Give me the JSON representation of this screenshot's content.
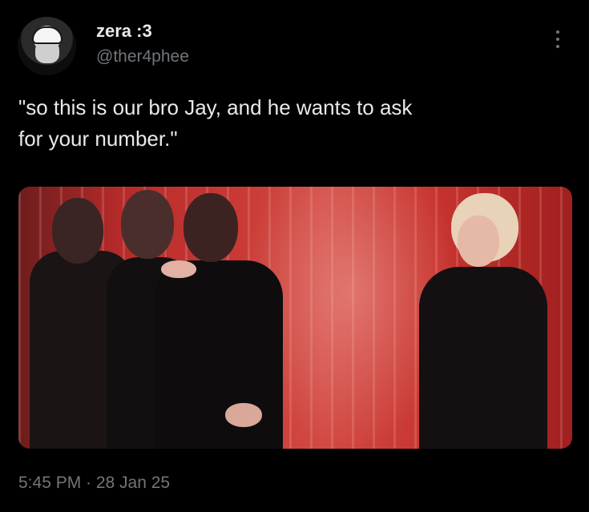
{
  "author": {
    "display_name": "zera :3",
    "handle": "@ther4phee"
  },
  "tweet": {
    "text": "\"so this is our bro Jay, and he wants to ask\nfor your number.\"",
    "timestamp": "5:45 PM · 28 Jan 25"
  },
  "icons": {
    "more": "more-vertical-icon",
    "avatar": "avatar-image"
  },
  "colors": {
    "background": "#000000",
    "primary_text": "#e7e9ea",
    "secondary_text": "#71767b",
    "media_red": "#c93a35"
  }
}
